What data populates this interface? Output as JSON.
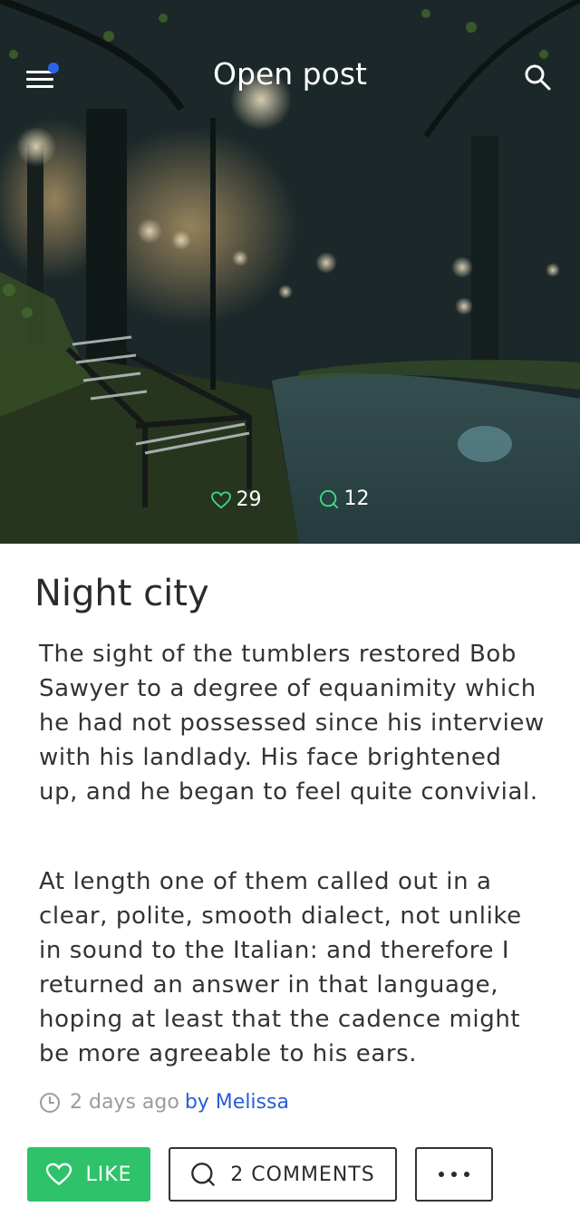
{
  "header": {
    "title": "Open post",
    "menu_icon": "hamburger-menu-icon",
    "notification_dot_color": "#2b63e8",
    "search_icon": "search-icon"
  },
  "hero": {
    "image_icon": "night-park-bench-image",
    "likes_count": "29",
    "comments_count": "12",
    "accent_color": "#3ddc84"
  },
  "post": {
    "title": "Night city",
    "paragraphs": [
      "The sight of the tumblers restored Bob Sawyer to a degree of equanimity which he had not possessed since his interview with his landlady. His face brightened up, and he began to feel quite convivial.",
      "At length one of them called out in a clear, polite, smooth dialect, not unlike in sound to the Italian: and therefore I returned an answer in that language, hoping at least that the cadence might be more agreeable to his ears."
    ],
    "time_ago": "2 days ago",
    "author": "by Melissa",
    "author_color": "#2a5bd7"
  },
  "actions": {
    "like_label": "LIKE",
    "like_color": "#2ec26a",
    "comments_label": "2 COMMENTS",
    "more_icon": "more-dots-icon"
  }
}
